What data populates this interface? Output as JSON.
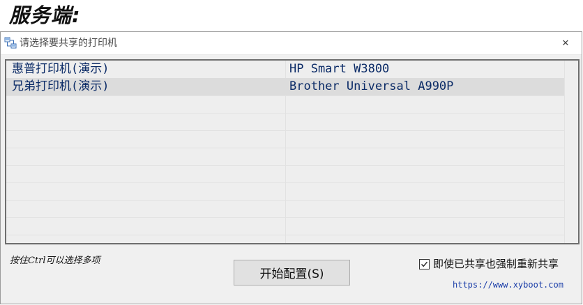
{
  "heading": "服务端:",
  "window": {
    "title": "请选择要共享的打印机",
    "close_glyph": "✕"
  },
  "printers": [
    {
      "name": "惠普打印机(演示)",
      "model": "HP Smart W3800",
      "selected": false
    },
    {
      "name": "兄弟打印机(演示)",
      "model": "Brother Universal A990P",
      "selected": true
    }
  ],
  "hint": "按住Ctrl可以选择多项",
  "config_button": "开始配置(S)",
  "force_share": {
    "label": "即使已共享也强制重新共享",
    "checked": true
  },
  "site_link": "https://www.xyboot.com",
  "icons": {
    "app": "printer-network-icon",
    "close": "close-icon",
    "check": "checkmark-icon"
  },
  "colors": {
    "list_text": "#0a2a66",
    "link": "#1a3da8",
    "selection": "#dcdcdc"
  }
}
